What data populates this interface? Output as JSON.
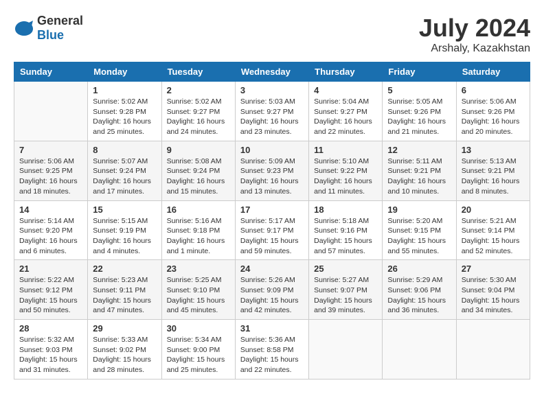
{
  "header": {
    "logo_general": "General",
    "logo_blue": "Blue",
    "month_year": "July 2024",
    "location": "Arshaly, Kazakhstan"
  },
  "columns": [
    "Sunday",
    "Monday",
    "Tuesday",
    "Wednesday",
    "Thursday",
    "Friday",
    "Saturday"
  ],
  "weeks": [
    [
      {
        "day": "",
        "info": ""
      },
      {
        "day": "1",
        "info": "Sunrise: 5:02 AM\nSunset: 9:28 PM\nDaylight: 16 hours\nand 25 minutes."
      },
      {
        "day": "2",
        "info": "Sunrise: 5:02 AM\nSunset: 9:27 PM\nDaylight: 16 hours\nand 24 minutes."
      },
      {
        "day": "3",
        "info": "Sunrise: 5:03 AM\nSunset: 9:27 PM\nDaylight: 16 hours\nand 23 minutes."
      },
      {
        "day": "4",
        "info": "Sunrise: 5:04 AM\nSunset: 9:27 PM\nDaylight: 16 hours\nand 22 minutes."
      },
      {
        "day": "5",
        "info": "Sunrise: 5:05 AM\nSunset: 9:26 PM\nDaylight: 16 hours\nand 21 minutes."
      },
      {
        "day": "6",
        "info": "Sunrise: 5:06 AM\nSunset: 9:26 PM\nDaylight: 16 hours\nand 20 minutes."
      }
    ],
    [
      {
        "day": "7",
        "info": "Sunrise: 5:06 AM\nSunset: 9:25 PM\nDaylight: 16 hours\nand 18 minutes."
      },
      {
        "day": "8",
        "info": "Sunrise: 5:07 AM\nSunset: 9:24 PM\nDaylight: 16 hours\nand 17 minutes."
      },
      {
        "day": "9",
        "info": "Sunrise: 5:08 AM\nSunset: 9:24 PM\nDaylight: 16 hours\nand 15 minutes."
      },
      {
        "day": "10",
        "info": "Sunrise: 5:09 AM\nSunset: 9:23 PM\nDaylight: 16 hours\nand 13 minutes."
      },
      {
        "day": "11",
        "info": "Sunrise: 5:10 AM\nSunset: 9:22 PM\nDaylight: 16 hours\nand 11 minutes."
      },
      {
        "day": "12",
        "info": "Sunrise: 5:11 AM\nSunset: 9:21 PM\nDaylight: 16 hours\nand 10 minutes."
      },
      {
        "day": "13",
        "info": "Sunrise: 5:13 AM\nSunset: 9:21 PM\nDaylight: 16 hours\nand 8 minutes."
      }
    ],
    [
      {
        "day": "14",
        "info": "Sunrise: 5:14 AM\nSunset: 9:20 PM\nDaylight: 16 hours\nand 6 minutes."
      },
      {
        "day": "15",
        "info": "Sunrise: 5:15 AM\nSunset: 9:19 PM\nDaylight: 16 hours\nand 4 minutes."
      },
      {
        "day": "16",
        "info": "Sunrise: 5:16 AM\nSunset: 9:18 PM\nDaylight: 16 hours\nand 1 minute."
      },
      {
        "day": "17",
        "info": "Sunrise: 5:17 AM\nSunset: 9:17 PM\nDaylight: 15 hours\nand 59 minutes."
      },
      {
        "day": "18",
        "info": "Sunrise: 5:18 AM\nSunset: 9:16 PM\nDaylight: 15 hours\nand 57 minutes."
      },
      {
        "day": "19",
        "info": "Sunrise: 5:20 AM\nSunset: 9:15 PM\nDaylight: 15 hours\nand 55 minutes."
      },
      {
        "day": "20",
        "info": "Sunrise: 5:21 AM\nSunset: 9:14 PM\nDaylight: 15 hours\nand 52 minutes."
      }
    ],
    [
      {
        "day": "21",
        "info": "Sunrise: 5:22 AM\nSunset: 9:12 PM\nDaylight: 15 hours\nand 50 minutes."
      },
      {
        "day": "22",
        "info": "Sunrise: 5:23 AM\nSunset: 9:11 PM\nDaylight: 15 hours\nand 47 minutes."
      },
      {
        "day": "23",
        "info": "Sunrise: 5:25 AM\nSunset: 9:10 PM\nDaylight: 15 hours\nand 45 minutes."
      },
      {
        "day": "24",
        "info": "Sunrise: 5:26 AM\nSunset: 9:09 PM\nDaylight: 15 hours\nand 42 minutes."
      },
      {
        "day": "25",
        "info": "Sunrise: 5:27 AM\nSunset: 9:07 PM\nDaylight: 15 hours\nand 39 minutes."
      },
      {
        "day": "26",
        "info": "Sunrise: 5:29 AM\nSunset: 9:06 PM\nDaylight: 15 hours\nand 36 minutes."
      },
      {
        "day": "27",
        "info": "Sunrise: 5:30 AM\nSunset: 9:04 PM\nDaylight: 15 hours\nand 34 minutes."
      }
    ],
    [
      {
        "day": "28",
        "info": "Sunrise: 5:32 AM\nSunset: 9:03 PM\nDaylight: 15 hours\nand 31 minutes."
      },
      {
        "day": "29",
        "info": "Sunrise: 5:33 AM\nSunset: 9:02 PM\nDaylight: 15 hours\nand 28 minutes."
      },
      {
        "day": "30",
        "info": "Sunrise: 5:34 AM\nSunset: 9:00 PM\nDaylight: 15 hours\nand 25 minutes."
      },
      {
        "day": "31",
        "info": "Sunrise: 5:36 AM\nSunset: 8:58 PM\nDaylight: 15 hours\nand 22 minutes."
      },
      {
        "day": "",
        "info": ""
      },
      {
        "day": "",
        "info": ""
      },
      {
        "day": "",
        "info": ""
      }
    ]
  ]
}
